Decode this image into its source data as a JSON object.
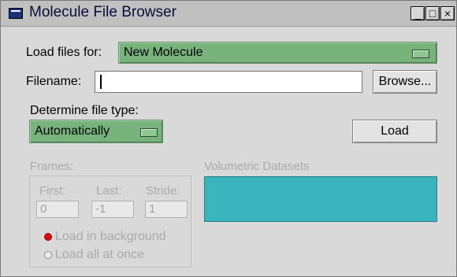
{
  "window": {
    "title": "Molecule File Browser",
    "controls": {
      "minimize": "_",
      "maximize": "□",
      "close": "×"
    }
  },
  "load_for": {
    "label": "Load files for:",
    "value": "New Molecule"
  },
  "filename": {
    "label": "Filename:",
    "value": "",
    "browse_label": "Browse..."
  },
  "file_type": {
    "label": "Determine file type:",
    "value": "Automatically"
  },
  "load_button": "Load",
  "frames": {
    "title": "Frames:",
    "first_label": "First:",
    "first_value": "0",
    "last_label": "Last:",
    "last_value": "-1",
    "stride_label": "Stride:",
    "stride_value": "1",
    "options": [
      {
        "label": "Load in background",
        "selected": true
      },
      {
        "label": "Load all at once",
        "selected": false
      }
    ]
  },
  "volumetric": {
    "title": "Volumetric Datasets"
  },
  "colors": {
    "dropdown_green": "#79b37c",
    "volumetric_teal": "#3ab5bd",
    "title_blue": "#1b2f7f"
  }
}
